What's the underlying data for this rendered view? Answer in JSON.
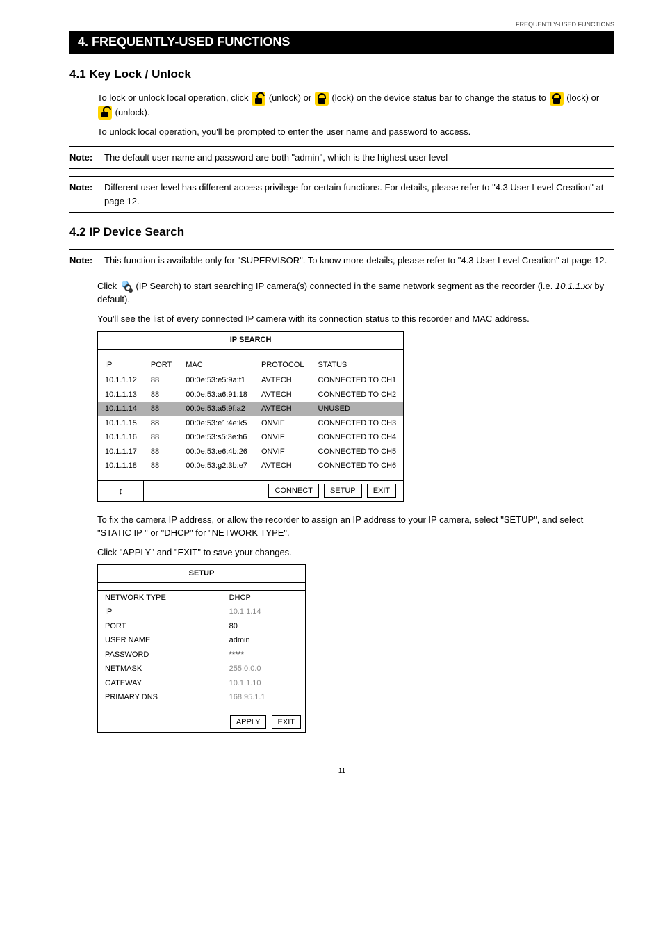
{
  "header": {
    "running_head": "FREQUENTLY-USED FUNCTIONS"
  },
  "title_bar": "4. FREQUENTLY-USED FUNCTIONS",
  "section_41": {
    "heading": "4.1 Key Lock / Unlock",
    "para1_a": "To lock or unlock local operation, click ",
    "para1_b": " (unlock) or ",
    "para1_c": " (lock) on the device status bar to change the status to ",
    "para1_d": " (lock) or ",
    "para1_e": " (unlock).",
    "para2": "To unlock local operation, you'll be prompted to enter the user name and password to access.",
    "note1_label": "Note:",
    "note1_text": "The default user name and password are both \"admin\", which is the highest user level",
    "note2_label": "Note:",
    "note2_text": "Different user level has different access privilege for certain functions. For details, please refer to \"4.3 User Level Creation\" at page 12."
  },
  "section_42": {
    "heading": "4.2 IP Device Search",
    "note_label": "Note:",
    "note_text": "This function is available only for \"SUPERVISOR\". To know more details, please refer to \"4.3 User Level Creation\" at page 12.",
    "para1_a": "Click ",
    "para1_b": " (IP Search) to start searching IP camera(s) connected in the same network segment as the recorder (i.e. ",
    "para1_c": "10.1.1.xx",
    "para1_d": " by default).",
    "para2": "You'll see the list of every connected IP camera with its connection status to this recorder and MAC address.",
    "para3": "To fix the camera IP address, or allow the recorder to assign an IP address to your IP camera, select \"SETUP\", and select \"STATIC IP \" or \"DHCP\" for \"NETWORK TYPE\".",
    "para4": "Click \"APPLY\" and \"EXIT\" to save your changes."
  },
  "ip_table": {
    "title": "IP SEARCH",
    "cols": {
      "ip": "IP",
      "port": "PORT",
      "mac": "MAC",
      "protocol": "PROTOCOL",
      "status": "STATUS"
    },
    "rows": [
      {
        "ip": "10.1.1.12",
        "port": "88",
        "mac": "00:0e:53:e5:9a:f1",
        "protocol": "AVTECH",
        "status": "CONNECTED TO CH1",
        "sel": false
      },
      {
        "ip": "10.1.1.13",
        "port": "88",
        "mac": "00:0e:53:a6:91:18",
        "protocol": "AVTECH",
        "status": "CONNECTED TO CH2",
        "sel": false
      },
      {
        "ip": "10.1.1.14",
        "port": "88",
        "mac": "00:0e:53:a5:9f:a2",
        "protocol": "AVTECH",
        "status": "UNUSED",
        "sel": true
      },
      {
        "ip": "10.1.1.15",
        "port": "88",
        "mac": "00:0e:53:e1:4e:k5",
        "protocol": "ONVIF",
        "status": "CONNECTED TO CH3",
        "sel": false
      },
      {
        "ip": "10.1.1.16",
        "port": "88",
        "mac": "00:0e:53:s5:3e:h6",
        "protocol": "ONVIF",
        "status": "CONNECTED TO CH4",
        "sel": false
      },
      {
        "ip": "10.1.1.17",
        "port": "88",
        "mac": "00:0e:53:e6:4b:26",
        "protocol": "ONVIF",
        "status": "CONNECTED TO CH5",
        "sel": false
      },
      {
        "ip": "10.1.1.18",
        "port": "88",
        "mac": "00:0e:53:g2:3b:e7",
        "protocol": "AVTECH",
        "status": "CONNECTED TO CH6",
        "sel": false
      }
    ],
    "buttons": {
      "connect": "CONNECT",
      "setup": "SETUP",
      "exit": "EXIT"
    },
    "swap_icon": "↕"
  },
  "setup_table": {
    "title": "SETUP",
    "rows": [
      {
        "label": "NETWORK TYPE",
        "value": "DHCP",
        "grey": false
      },
      {
        "label": "IP",
        "value": "10.1.1.14",
        "grey": true
      },
      {
        "label": "PORT",
        "value": "80",
        "grey": false
      },
      {
        "label": "USER NAME",
        "value": "admin",
        "grey": false
      },
      {
        "label": "PASSWORD",
        "value": "*****",
        "grey": false
      },
      {
        "label": "NETMASK",
        "value": "255.0.0.0",
        "grey": true
      },
      {
        "label": "GATEWAY",
        "value": "10.1.1.10",
        "grey": true
      },
      {
        "label": "PRIMARY DNS",
        "value": "168.95.1.1",
        "grey": true
      }
    ],
    "buttons": {
      "apply": "APPLY",
      "exit": "EXIT"
    }
  },
  "page_number": "11"
}
